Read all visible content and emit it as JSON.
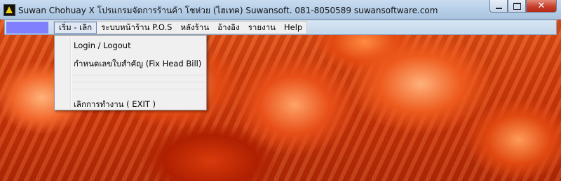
{
  "window": {
    "title": "Suwan Chohuay X   โปรแกรมจัดการร้านค้า โชห่วย  (ไฮเทค)          Suwansoft.  081-8050589    suwansoftware.com",
    "icon": "app-logo-icon",
    "buttons": {
      "minimize": "minimize-icon",
      "maximize": "maximize-icon",
      "close": "✕"
    }
  },
  "menubar": {
    "items": [
      {
        "label": "เริ่ม - เลิก",
        "active": true
      },
      {
        "label": "ระบบหน้าร้าน P.O.S"
      },
      {
        "label": "หลังร้าน"
      },
      {
        "label": "อ้างอิง"
      },
      {
        "label": "รายงาน"
      },
      {
        "label": "Help"
      }
    ]
  },
  "dropdown": {
    "items": [
      {
        "label": "Login / Logout"
      },
      {
        "label": "กำหนดเลขใบสำคัญ (Fix Head Bill)"
      },
      {
        "label": "เลิกการทำงาน ( EXIT )"
      }
    ]
  },
  "colors": {
    "menu_swatch": "#8080ff",
    "titlebar": "#b7cfe8",
    "close_button": "#c8402c"
  }
}
